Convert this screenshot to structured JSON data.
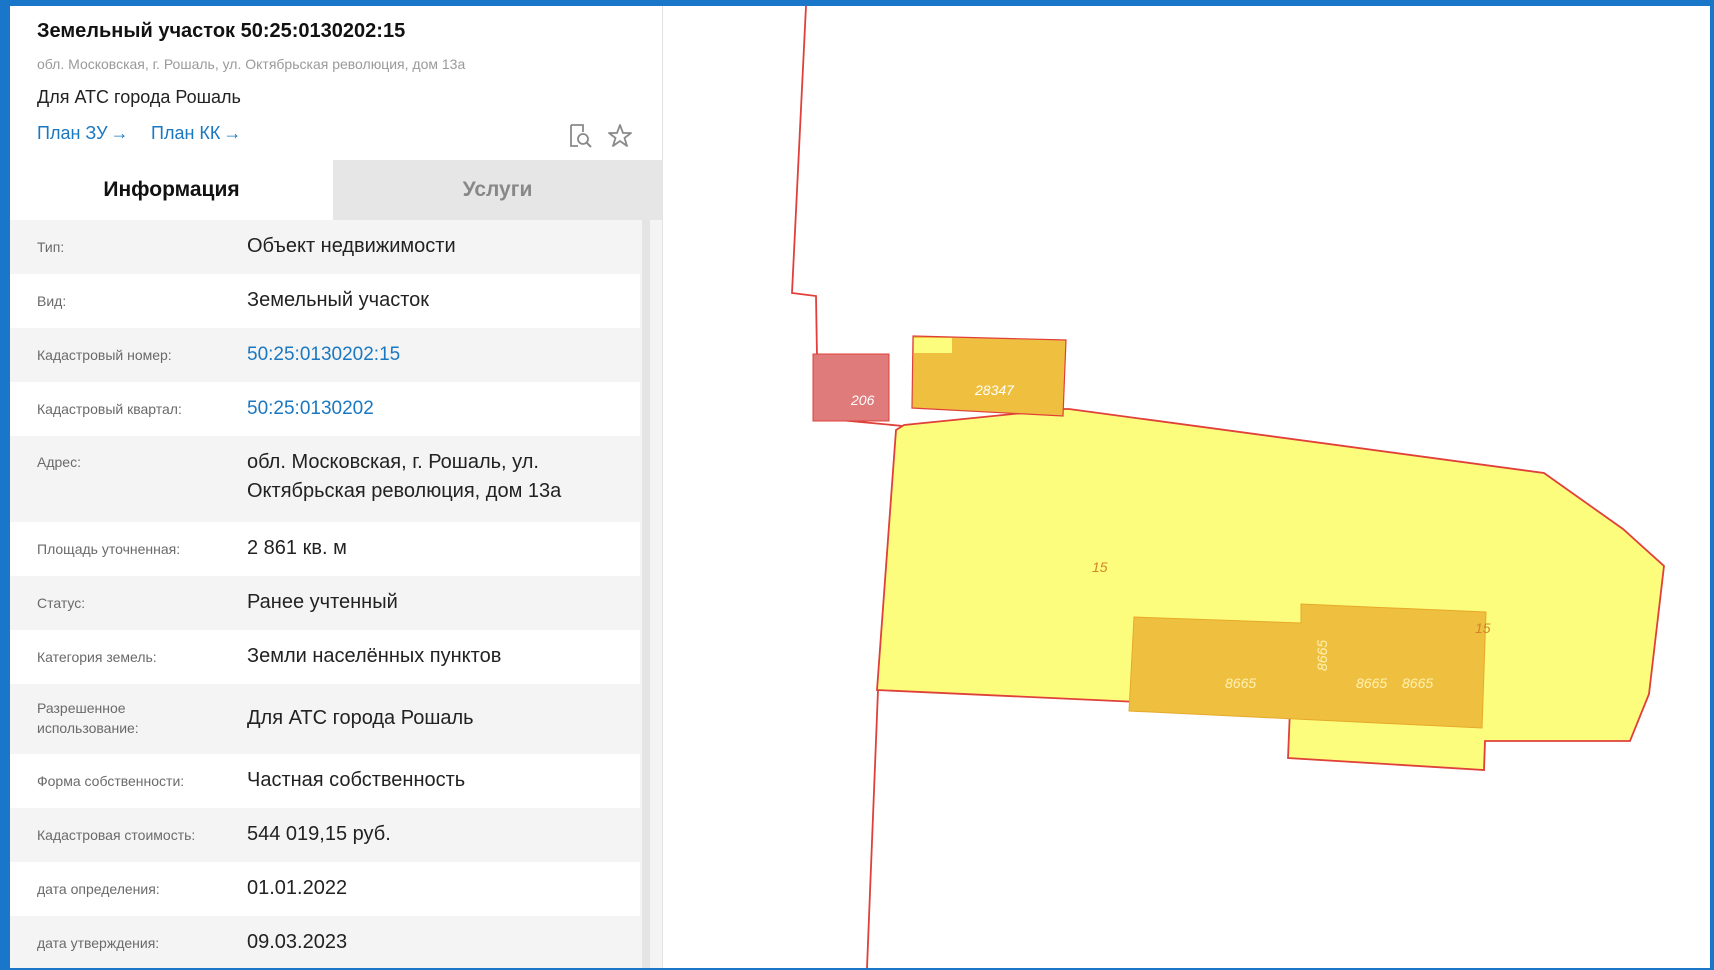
{
  "header": {
    "title": "Земельный участок 50:25:0130202:15",
    "address_small": "обл. Московская, г. Рошаль, ул. Октябрьская революция, дом 13а",
    "purpose": "Для АТС города Рошаль",
    "links": [
      {
        "label": "План ЗУ",
        "arrow": "→"
      },
      {
        "label": "План КК",
        "arrow": "→"
      }
    ],
    "icons": [
      "document-search-icon",
      "star-icon"
    ]
  },
  "tabs": [
    {
      "label": "Информация",
      "active": true
    },
    {
      "label": "Услуги",
      "active": false
    }
  ],
  "info": {
    "type_label": "Тип:",
    "type_value": "Объект недвижимости",
    "kind_label": "Вид:",
    "kind_value": "Земельный участок",
    "cad_num_label": "Кадастровый номер:",
    "cad_num_value": "50:25:0130202:15",
    "cad_q_label": "Кадастровый квартал:",
    "cad_q_value": "50:25:0130202",
    "address_label": "Адрес:",
    "address_line1": "обл. Московская, г. Рошаль, ул.",
    "address_line2": "Октябрьская революция, дом 13а",
    "area_label": "Площадь уточненная:",
    "area_value": "2 861 кв. м",
    "status_label": "Статус:",
    "status_value": "Ранее учтенный",
    "category_label": "Категория земель:",
    "category_value": "Земли населённых пунктов",
    "use_label_1": "Разрешенное",
    "use_label_2": "использование:",
    "use_value": "Для АТС города Рошаль",
    "ownership_label": "Форма собственности:",
    "ownership_value": "Частная собственность",
    "cost_label": "Кадастровая стоимость:",
    "cost_value": "544 019,15 руб.",
    "date_def_label": "дата определения:",
    "date_def_value": "01.01.2022",
    "date_appr_label": "дата утверждения:",
    "date_appr_value": "09.03.2023"
  },
  "map": {
    "parcel_labels": {
      "p206": "206",
      "p28347": "28347",
      "p15_center": "15",
      "p15_right": "15",
      "b8665_a": "8665",
      "b8665_b": "8665",
      "b8665_c": "8665",
      "b8665_v": "8665"
    },
    "colors": {
      "parcel_fill": "#fdfd7d",
      "building_fill": "#efbf40",
      "selected_fill": "#e07b7b",
      "boundary": "#e0403a",
      "frame_border": "#1976c9"
    }
  }
}
